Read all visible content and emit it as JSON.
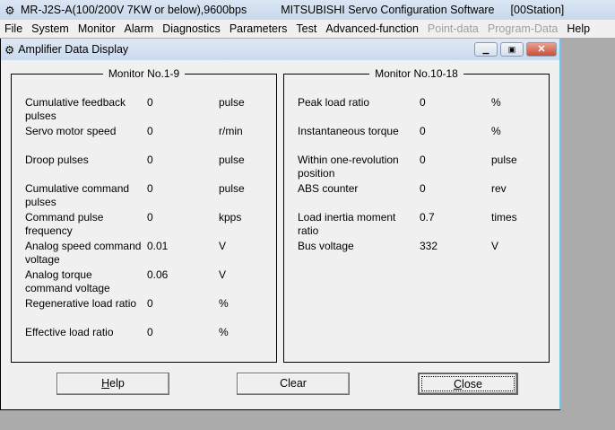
{
  "app": {
    "title_left": "MR-J2S-A(100/200V 7KW or below),9600bps",
    "title_right": "MITSUBISHI Servo Configuration Software",
    "station": "[00Station]"
  },
  "menu": [
    "File",
    "System",
    "Monitor",
    "Alarm",
    "Diagnostics",
    "Parameters",
    "Test",
    "Advanced-function",
    "Point-data",
    "Program-Data",
    "Help"
  ],
  "window": {
    "title": "Amplifier Data Display"
  },
  "left": {
    "title": "Monitor No.1-9",
    "rows": [
      {
        "label": "Cumulative feedback pulses",
        "value": "0",
        "unit": "pulse"
      },
      {
        "label": "Servo motor speed",
        "value": "0",
        "unit": "r/min"
      },
      {
        "label": "Droop pulses",
        "value": "0",
        "unit": "pulse"
      },
      {
        "label": "Cumulative command pulses",
        "value": "0",
        "unit": "pulse"
      },
      {
        "label": "Command pulse frequency",
        "value": "0",
        "unit": "kpps"
      },
      {
        "label": "Analog speed command voltage",
        "value": "0.01",
        "unit": "V"
      },
      {
        "label": "Analog torque command voltage",
        "value": "0.06",
        "unit": "V"
      },
      {
        "label": "Regenerative load ratio",
        "value": "0",
        "unit": "%"
      },
      {
        "label": "Effective load ratio",
        "value": "0",
        "unit": "%"
      }
    ]
  },
  "right": {
    "title": "Monitor No.10-18",
    "rows": [
      {
        "label": "Peak load ratio",
        "value": "0",
        "unit": "%"
      },
      {
        "label": "Instantaneous torque",
        "value": "0",
        "unit": "%"
      },
      {
        "label": "Within one-revolution position",
        "value": "0",
        "unit": "pulse"
      },
      {
        "label": "ABS counter",
        "value": "0",
        "unit": "rev"
      },
      {
        "label": "Load inertia moment ratio",
        "value": "0.7",
        "unit": "times"
      },
      {
        "label": "Bus voltage",
        "value": "332",
        "unit": "V"
      }
    ]
  },
  "buttons": {
    "help_key": "H",
    "help_rest": "elp",
    "clear": "Clear",
    "close_key": "C",
    "close_rest": "lose"
  }
}
